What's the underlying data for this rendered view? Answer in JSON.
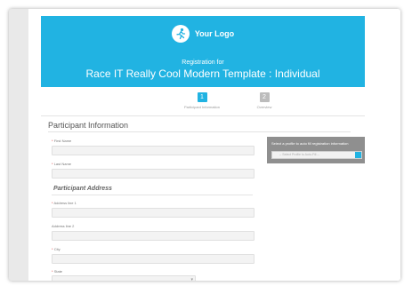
{
  "header": {
    "logo_text": "Your Logo",
    "registration_for": "Registration for",
    "event_title": "Race IT Really Cool Modern Template : Individual",
    "logo_icon": "runner-icon",
    "accent_color": "#21b3e2"
  },
  "steps": [
    {
      "number": "1",
      "label": "Participant Information",
      "active": true
    },
    {
      "number": "2",
      "label": "Overview",
      "active": false
    }
  ],
  "form": {
    "section_title": "Participant Information",
    "required_marker": "*",
    "fields": {
      "first_name": {
        "label": "First Name",
        "required": true,
        "value": ""
      },
      "last_name": {
        "label": "Last Name",
        "required": true,
        "value": ""
      },
      "address_line_1": {
        "label": "Address line 1",
        "required": true,
        "value": ""
      },
      "address_line_2": {
        "label": "Address line 2",
        "required": false,
        "value": ""
      },
      "city": {
        "label": "City",
        "required": true,
        "value": ""
      },
      "state": {
        "label": "State",
        "required": true,
        "value": ""
      }
    },
    "address_subhead": "Participant Address"
  },
  "profile_panel": {
    "prompt": "Select a profile to auto fill registration information",
    "select_placeholder": "-- Select Profile to Auto-Fill --"
  }
}
